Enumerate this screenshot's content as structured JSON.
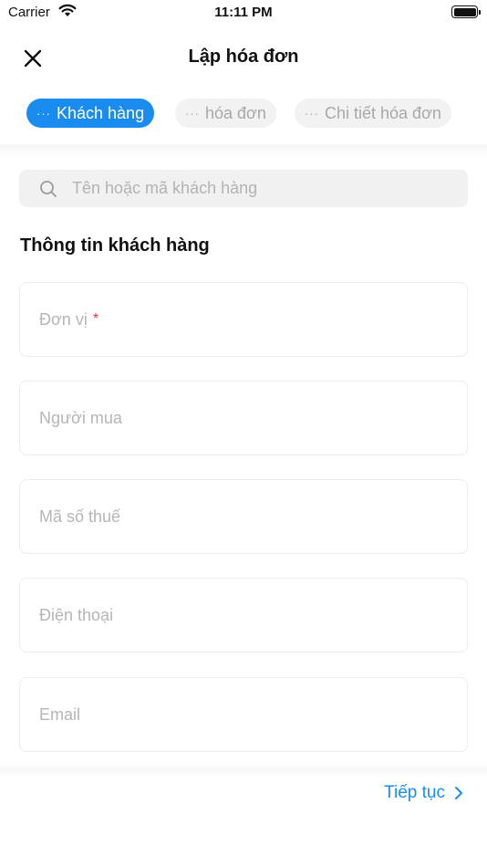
{
  "status_bar": {
    "carrier": "Carrier",
    "time": "11:11 PM"
  },
  "nav": {
    "title": "Lập hóa đơn"
  },
  "steps": [
    {
      "dots": "···",
      "label": "Khách hàng",
      "active": true
    },
    {
      "dots": "···",
      "label": "hóa đơn",
      "active": false
    },
    {
      "dots": "···",
      "label": "Chi tiết hóa đơn",
      "active": false
    }
  ],
  "search": {
    "placeholder": "Tên hoặc mã khách hàng"
  },
  "section": {
    "title": "Thông tin khách hàng"
  },
  "fields": [
    {
      "label": "Đơn vị",
      "required_mark": "*"
    },
    {
      "label": "Người mua"
    },
    {
      "label": "Mã số thuế"
    },
    {
      "label": "Điện thoại"
    },
    {
      "label": "Email"
    }
  ],
  "footer": {
    "next_label": "Tiếp tục"
  },
  "colors": {
    "accent": "#1a8cf0",
    "required": "#e8323b",
    "placeholder": "#b5b5b5"
  }
}
